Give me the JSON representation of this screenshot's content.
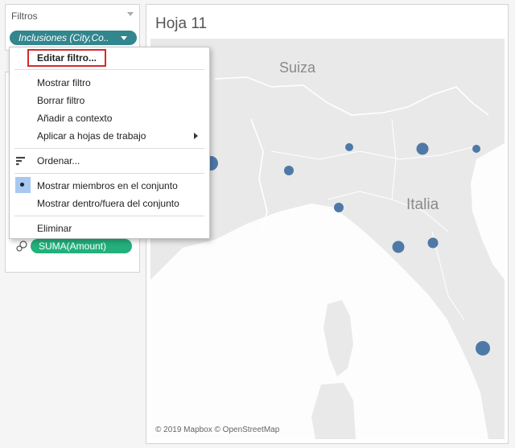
{
  "filters": {
    "title": "Filtros",
    "pill_label": "Inclusiones (City,Co.."
  },
  "marks": {
    "amount_pill": "SUMA(Amount)"
  },
  "sheet": {
    "title": "Hoja 11",
    "map_labels": {
      "suiza": "Suiza",
      "italia": "Italia"
    },
    "attribution": "© 2019 Mapbox © OpenStreetMap"
  },
  "menu": {
    "edit_filter": "Editar filtro...",
    "show_filter": "Mostrar filtro",
    "clear_filter": "Borrar filtro",
    "add_to_context": "Añadir a contexto",
    "apply_to_worksheets": "Aplicar a hojas de trabajo",
    "sort": "Ordenar...",
    "show_members_in_set": "Mostrar miembros en el conjunto",
    "show_in_out_set": "Mostrar dentro/fuera del conjunto",
    "remove": "Eliminar"
  },
  "colors": {
    "filter_pill": "#32868e",
    "measure_pill": "#23b07d",
    "map_marker": "#4e79a7",
    "highlight_border": "#d42b2b",
    "selected_bg": "#a6c8f2"
  },
  "icons": {
    "filters_menu": "caret-down-icon",
    "pill_menu": "caret-down-icon",
    "size_mark": "size-circles-icon",
    "sort": "sort-bars-icon",
    "submenu": "chevron-right-icon",
    "selected": "radio-dot-icon"
  }
}
